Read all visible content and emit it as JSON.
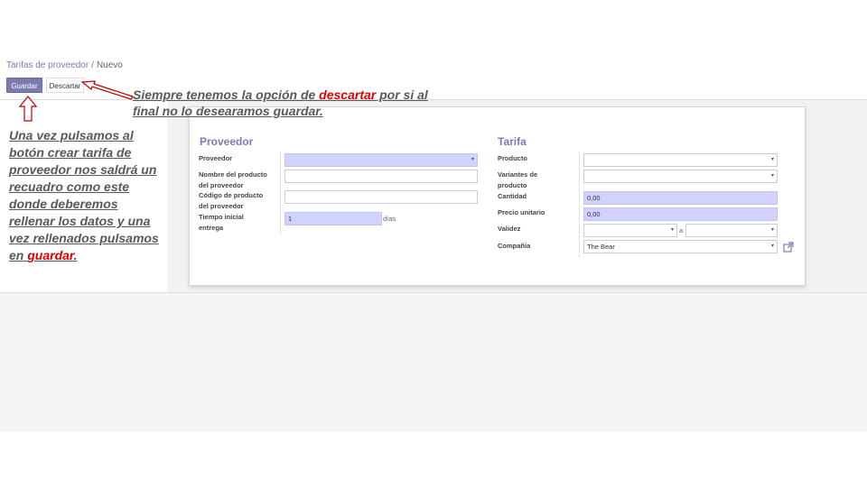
{
  "breadcrumb": {
    "parent": "Tarifas de proveedor",
    "separator": "/",
    "current": "Nuevo"
  },
  "toolbar": {
    "save_label": "Guardar",
    "discard_label": "Descartar"
  },
  "form": {
    "left": {
      "title": "Proveedor",
      "labels": {
        "vendor": "Proveedor",
        "product_name_1": "Nombre del producto",
        "product_name_2": "del proveedor",
        "product_code_1": "Código de producto",
        "product_code_2": "del proveedor",
        "lead_time_1": "Tiempo inicial",
        "lead_time_2": "entrega"
      },
      "values": {
        "vendor": "",
        "product_name": "",
        "product_code": "",
        "lead_time": "1"
      },
      "lead_time_unit": "días"
    },
    "right": {
      "title": "Tarifa",
      "labels": {
        "product": "Producto",
        "variants_1": "Variantes de",
        "variants_2": "producto",
        "quantity": "Cantidad",
        "unit_price": "Precio unitario",
        "validity": "Validez",
        "company": "Compañía"
      },
      "values": {
        "product": "",
        "variants": "",
        "quantity": "0,00",
        "unit_price": "0,00",
        "validity_from": "",
        "validity_to": "",
        "company": "The Bear"
      },
      "validity_separator": "a"
    }
  },
  "annotations": {
    "discard_note": {
      "before": "Siempre tenemos la opción de ",
      "highlight": "descartar",
      "after": " por si al final no lo desearamos guardar."
    },
    "save_note": {
      "before": "Una vez pulsamos al botón crear tarifa de proveedor nos saldrá un recuadro como este donde deberemos rellenar los datos y una vez rellenados pulsamos en ",
      "highlight": "guardar",
      "after": "."
    }
  },
  "icons": {
    "dropdown": "caret-down-icon",
    "external_link": "external-link-icon",
    "arrow": "callout-arrow-icon"
  },
  "colors": {
    "primary": "#7c7bad",
    "required_field": "#d2d2ff",
    "highlight": "#e00000",
    "annotation_text": "#595959"
  }
}
